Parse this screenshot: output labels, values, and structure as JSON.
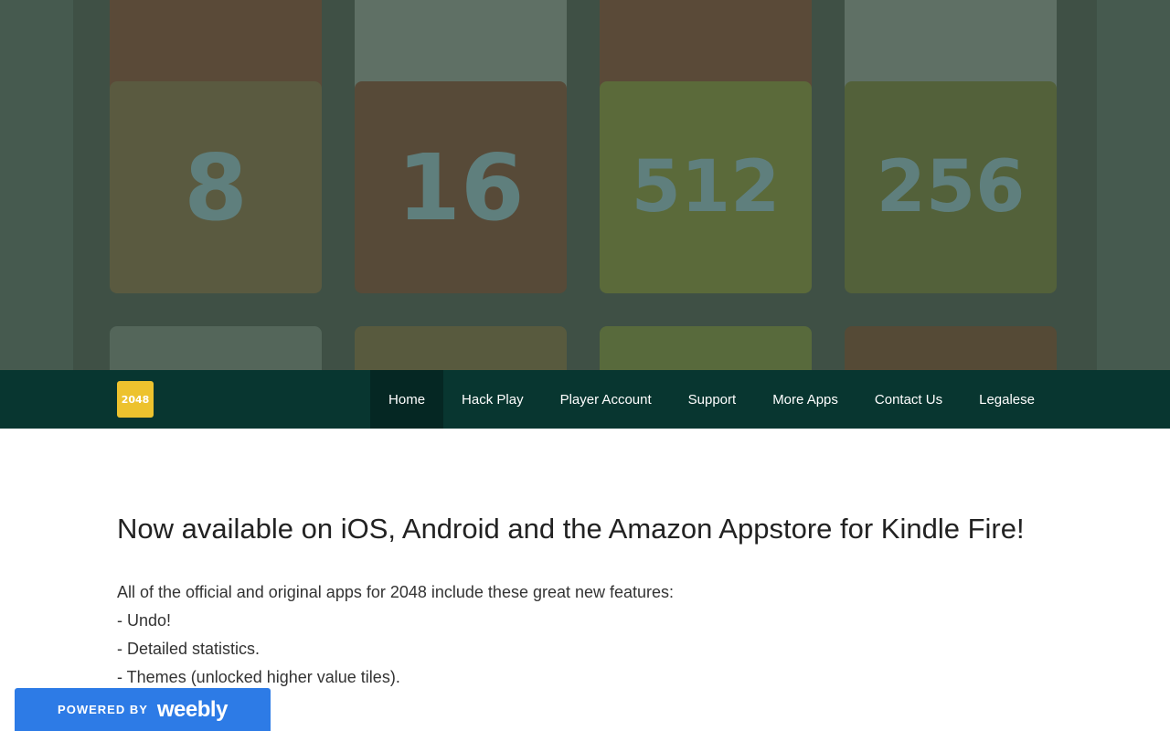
{
  "hero": {
    "tiles": [
      {
        "label": "",
        "color": "#5a4a38"
      },
      {
        "label": "",
        "color": "#5f7065"
      },
      {
        "label": "",
        "color": "#5a4a38"
      },
      {
        "label": "",
        "color": "#5f7065"
      },
      {
        "label": "8",
        "color": "#5a5a40"
      },
      {
        "label": "16",
        "color": "#574a38"
      },
      {
        "label": "512",
        "color": "#5b6a3a"
      },
      {
        "label": "256",
        "color": "#53613a"
      },
      {
        "label": "",
        "color": "#54665a"
      },
      {
        "label": "",
        "color": "#585a3e"
      },
      {
        "label": "",
        "color": "#586a3c"
      },
      {
        "label": "",
        "color": "#554a36"
      }
    ]
  },
  "nav": {
    "logo_text": "2048",
    "items": [
      {
        "label": "Home"
      },
      {
        "label": "Hack Play"
      },
      {
        "label": "Player Account"
      },
      {
        "label": "Support"
      },
      {
        "label": "More Apps"
      },
      {
        "label": "Contact Us"
      },
      {
        "label": "Legalese"
      }
    ],
    "active_item": "Home"
  },
  "main": {
    "heading": "Now available on iOS, Android and the Amazon Appstore for Kindle Fire!",
    "intro": "All of the official and original apps for 2048 include these great new features:",
    "features": [
      "- Undo!",
      "- Detailed statistics.",
      "- Themes (unlocked higher value tiles)."
    ]
  },
  "badge": {
    "prefix": "POWERED BY",
    "brand": "weebly"
  },
  "colors": {
    "nav_bg": "#083630",
    "nav_active": "#052723",
    "logo_bg": "#edc22e",
    "badge_bg": "#2d7be6"
  }
}
